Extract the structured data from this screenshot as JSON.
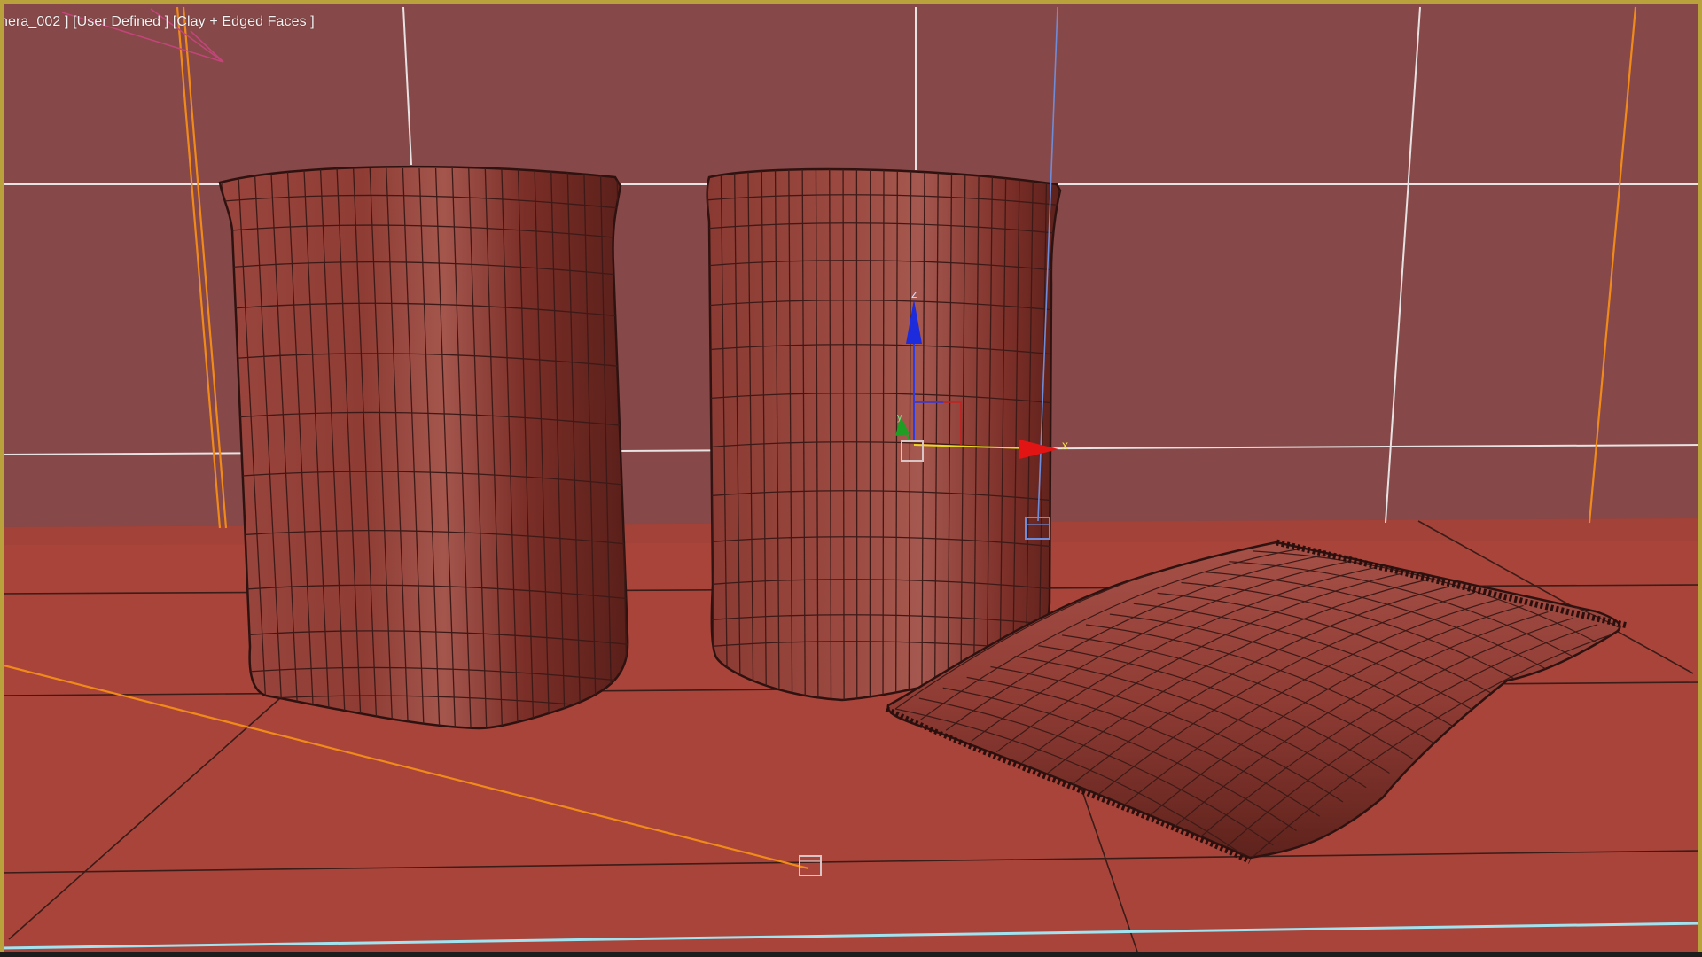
{
  "viewport": {
    "label_parts": {
      "camera": "nera_002 ]",
      "view_mode": "[User Defined ]",
      "shading": "[Clay + Edged Faces ]"
    },
    "gizmo_axes": {
      "x": "x",
      "y": "y",
      "z": "z"
    },
    "colors": {
      "wall": "#864848",
      "floor": "#a9443a",
      "object": "#8a3a32",
      "wire": "#3d1a17",
      "grid_light": "#e8e2e2",
      "grid_dark": "#3a1c18",
      "camera_line": "#f08a1a",
      "cyan_line": "#9fe4f0",
      "selection_border": "#b9a23c"
    },
    "objects": [
      "sack-standing-left",
      "sack-standing-right",
      "sack-lying"
    ]
  }
}
